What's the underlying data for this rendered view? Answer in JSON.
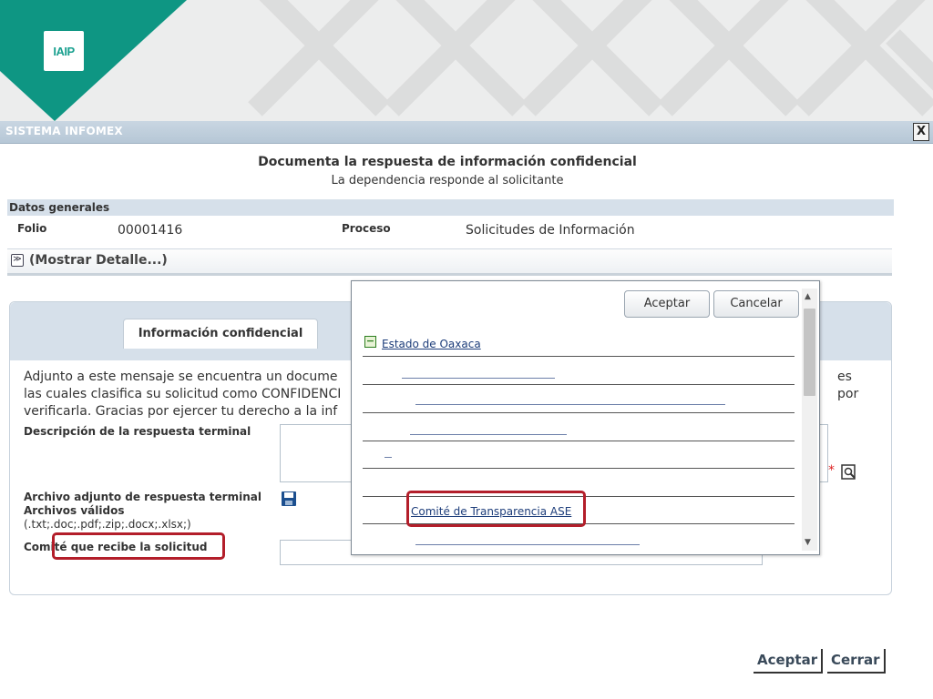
{
  "brand": {
    "logo_text": "IAIP",
    "accent_color": "#1aa08f"
  },
  "window": {
    "title": "SISTEMA INFOMEX",
    "close_label": "X"
  },
  "form": {
    "title": "Documenta la respuesta de información confidencial",
    "subtitle": "La dependencia responde al solicitante"
  },
  "datos_generales": {
    "header": "Datos generales",
    "folio_label": "Folio",
    "folio_value": "00001416",
    "proceso_label": "Proceso",
    "proceso_value": "Solicitudes de Información",
    "detail_toggle": "(Mostrar Detalle...)"
  },
  "panel": {
    "tab_label": "Información confidencial",
    "notice_line1_left": "Adjunto a este mensaje se encuentra un docume",
    "notice_line1_right": "es por",
    "notice_line2": "las cuales clasifica su solicitud como CONFIDENCI",
    "notice_line3": "verificarla. Gracias por ejercer tu derecho a la inf",
    "desc_label": "Descripción de la respuesta terminal",
    "archivo_label": "Archivo adjunto de respuesta terminal",
    "archivos_validos_label": "Archivos válidos",
    "archivos_validos_ext": "(.txt;.doc;.pdf;.zip;.docx;.xlsx;)",
    "comite_label": "Comité que recibe la solicitud",
    "required_mark": "*"
  },
  "popup": {
    "accept_label": "Aceptar",
    "cancel_label": "Cancelar",
    "tree_root": "Estado de Oaxaca",
    "tree_selected": "Comité de Transparencia ASE"
  },
  "footer": {
    "accept_label": "Aceptar",
    "close_label": "Cerrar"
  },
  "icons": {
    "collapse": "minus-square-icon",
    "detail": "chevron-double-down-icon",
    "save": "floppy-disk-icon",
    "search": "magnifier-icon",
    "scroll_up": "triangle-up-icon",
    "scroll_down": "triangle-down-icon"
  }
}
